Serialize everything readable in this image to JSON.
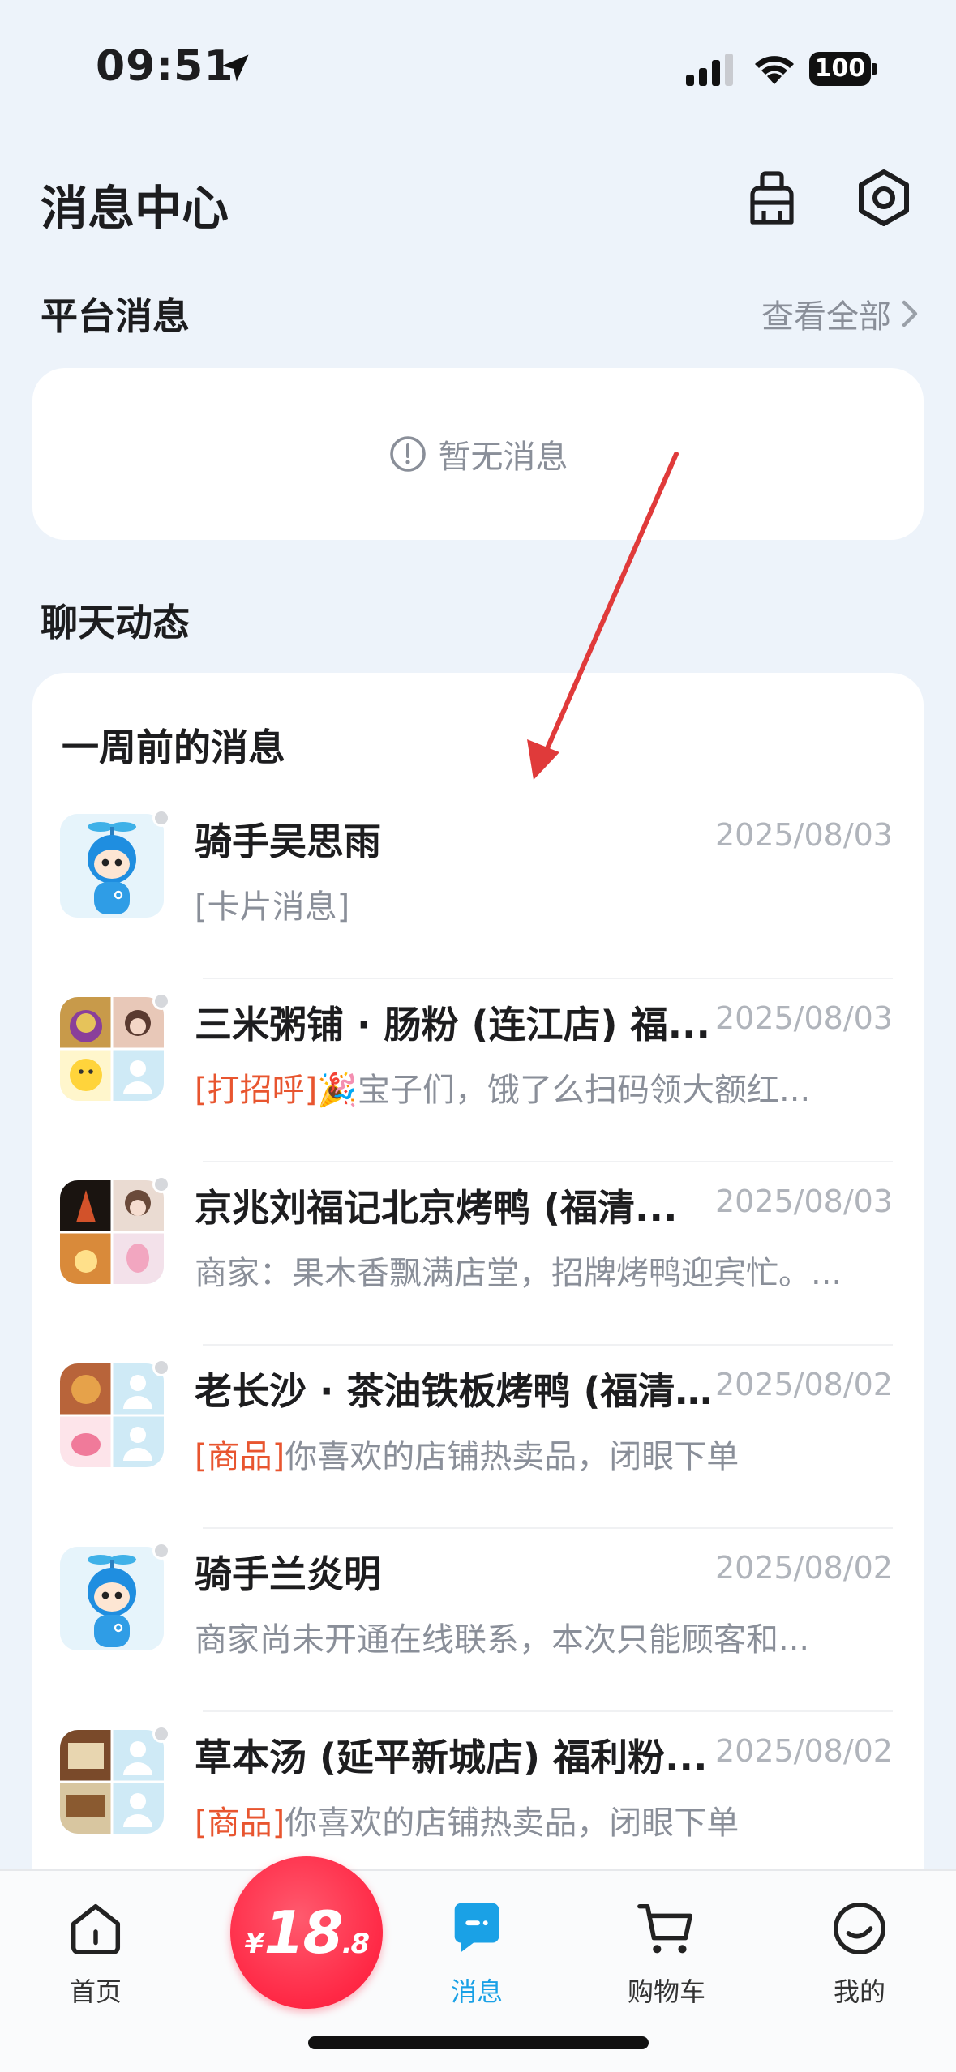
{
  "status_bar": {
    "time": "09:51",
    "battery": "100"
  },
  "header": {
    "title": "消息中心"
  },
  "platform": {
    "title": "平台消息",
    "view_all": "查看全部",
    "empty_text": "暂无消息"
  },
  "chat": {
    "title": "聊天动态",
    "group_title": "一周前的消息",
    "items": [
      {
        "name": "骑手吴思雨",
        "date": "2025/08/03",
        "tag": "",
        "preview": "[卡片消息]"
      },
      {
        "name": "三米粥铺 · 肠粉 (连江店) 福...",
        "date": "2025/08/03",
        "tag": "[打招呼]",
        "preview": "🎉宝子们，饿了么扫码领大额红..."
      },
      {
        "name": "京兆刘福记北京烤鸭 (福清...",
        "date": "2025/08/03",
        "tag": "",
        "preview": "商家：果木香飘满店堂，招牌烤鸭迎宾忙。..."
      },
      {
        "name": "老长沙 · 茶油铁板烤鸭 (福清...",
        "date": "2025/08/02",
        "tag": "[商品]",
        "preview": "你喜欢的店铺热卖品，闭眼下单"
      },
      {
        "name": "骑手兰炎明",
        "date": "2025/08/02",
        "tag": "",
        "preview": "商家尚未开通在线联系，本次只能顾客和..."
      },
      {
        "name": "草本汤 (延平新城店) 福利粉...",
        "date": "2025/08/02",
        "tag": "[商品]",
        "preview": "你喜欢的店铺热卖品，闭眼下单"
      }
    ]
  },
  "nav": {
    "home": "首页",
    "promo_currency": "¥",
    "promo_amount": "18",
    "promo_decimal": ".8",
    "messages": "消息",
    "cart": "购物车",
    "me": "我的"
  },
  "colors": {
    "accent": "#1aa1e6",
    "tag": "#e8552f",
    "promo": "#ff2845",
    "annotation": "#e03a3a"
  }
}
